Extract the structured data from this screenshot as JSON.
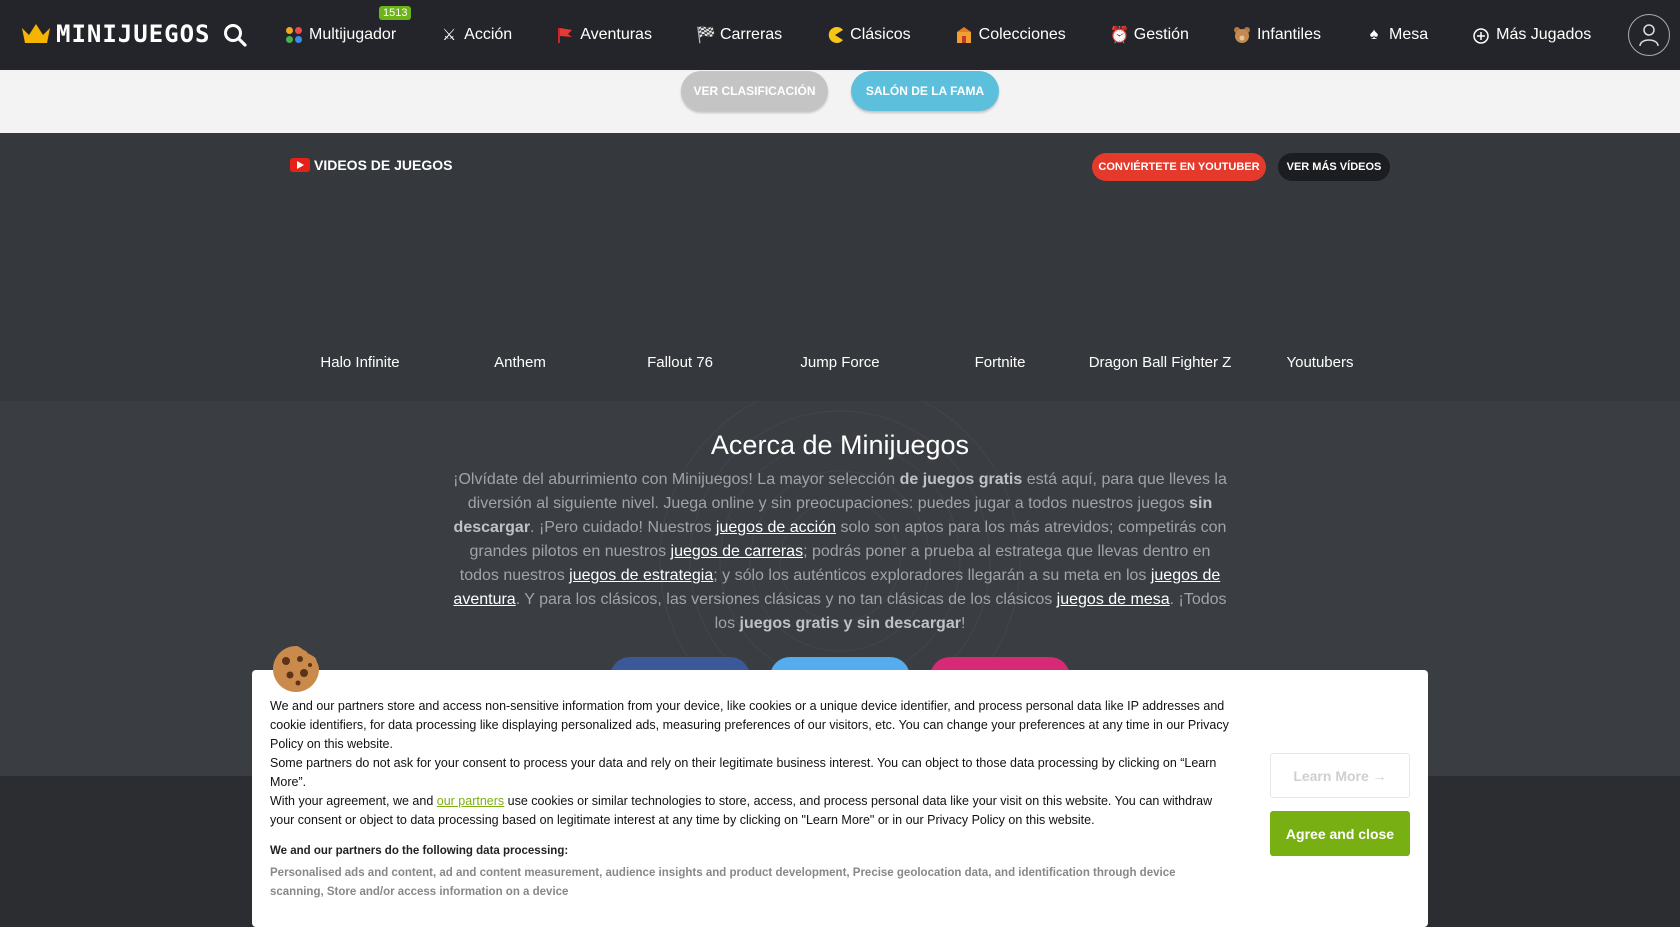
{
  "header": {
    "logo_text": "MINIJUEGOS",
    "nav": [
      {
        "label": "Multijugador",
        "icon": "dots-icon"
      },
      {
        "label": "Acción",
        "icon": "swords-icon"
      },
      {
        "label": "Aventuras",
        "icon": "flag-icon"
      },
      {
        "label": "Carreras",
        "icon": "checkered-flag-icon"
      },
      {
        "label": "Clásicos",
        "icon": "pacman-icon"
      },
      {
        "label": "Colecciones",
        "icon": "collection-icon"
      },
      {
        "label": "Gestión",
        "icon": "alarm-clock-icon"
      },
      {
        "label": "Infantiles",
        "icon": "teddy-bear-icon"
      },
      {
        "label": "Mesa",
        "icon": "spade-icon"
      },
      {
        "label": "Más Jugados",
        "icon": "plus-circle-icon"
      }
    ],
    "multijugador_badge": "1513"
  },
  "ranking": {
    "ver_clasificacion": "VER CLASIFICACIÓN",
    "salon_fama": "SALÓN DE LA FAMA"
  },
  "videos": {
    "title": "VIDEOS DE JUEGOS",
    "youtuber_btn": "CONVIÉRTETE EN YOUTUBER",
    "more_btn": "VER MÁS VÍDEOS",
    "items": [
      "Halo Infinite",
      "Anthem",
      "Fallout 76",
      "Jump Force",
      "Fortnite",
      "Dragon Ball Fighter Z",
      "Youtubers"
    ]
  },
  "about": {
    "title": "Acerca de Minijuegos",
    "t1": "¡Olvídate del aburrimiento con Minijuegos! La mayor selección ",
    "b1": "de juegos gratis",
    "t2": " está aquí, para que lleves la diversión al siguiente nivel. Juega online y sin preocupaciones: puedes jugar a todos nuestros juegos ",
    "b2": "sin descargar",
    "t3": ". ¡Pero cuidado! Nuestros ",
    "l1": "juegos de acción",
    "t4": " solo son aptos para los más atrevidos; competirás con grandes pilotos en nuestros ",
    "l2": "juegos de carreras",
    "t5": "; podrás poner a prueba al estratega que llevas dentro en todos nuestros ",
    "l3": "juegos de estrategia",
    "t6": "; y sólo los auténticos exploradores llegarán a su meta en los ",
    "l4": "juegos de aventura",
    "t7": ". Y para los clásicos, las versiones clásicas y no tan clásicas de los clásicos ",
    "l5": "juegos de mesa",
    "t8": ". ¡Todos los ",
    "b3": "juegos gratis y sin descargar",
    "t9": "!"
  },
  "cookie": {
    "p1": "We and our partners store and access non-sensitive information from your device, like cookies or a unique device identifier, and process personal data like IP addresses and cookie identifiers, for data processing like displaying personalized ads, measuring preferences of our visitors, etc. You can change your preferences at any time in our Privacy Policy on this website.",
    "p2": "Some partners do not ask for your consent to process your data and rely on their legitimate business interest. You can object to those data processing by clicking on “Learn More”.",
    "p3a": "With your agreement, we and ",
    "p3link": "our partners",
    "p3b": " use cookies or similar technologies to store, access, and process personal data like your visit on this website. You can withdraw your consent or object to data processing based on legitimate interest at any time by clicking on \"Learn More\" or in our Privacy Policy on this website.",
    "proc_title": "We and our partners do the following data processing:",
    "proc_list": "Personalised ads and content, ad and content measurement, audience insights and product development, Precise geolocation data, and identification through device scanning, Store and/or access information on a device",
    "learn_more": "Learn More →",
    "agree": "Agree and close"
  }
}
